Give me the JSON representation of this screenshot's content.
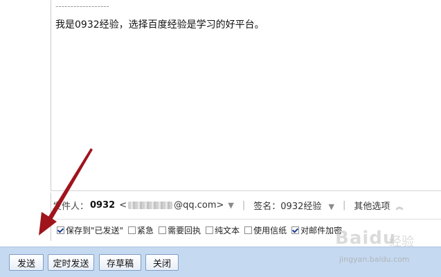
{
  "editor": {
    "signature_dashes": "------------------",
    "body_text": "我是0932经验，选择百度经验是学习的好平台。"
  },
  "sender": {
    "label": "发件人：",
    "name": "0932",
    "email_prefix": "<",
    "email_suffix": "@qq.com>",
    "signature_label": "签名：",
    "signature_value": "0932经验",
    "other_options": "其他选项"
  },
  "options": [
    {
      "label": "保存到\"已发送\"",
      "checked": true
    },
    {
      "label": "紧急",
      "checked": false
    },
    {
      "label": "需要回执",
      "checked": false
    },
    {
      "label": "纯文本",
      "checked": false
    },
    {
      "label": "使用信纸",
      "checked": false
    },
    {
      "label": "对邮件加密",
      "checked": true
    }
  ],
  "toolbar": {
    "send": "发送",
    "scheduled_send": "定时发送",
    "save_draft": "存草稿",
    "close": "关闭"
  },
  "watermark": {
    "logo_text": "Baidu",
    "logo_suffix": "经验",
    "domain": "jingyan.baidu.com"
  },
  "colors": {
    "toolbar_bg": "#c5d9f0",
    "arrow": "#a0141c"
  }
}
